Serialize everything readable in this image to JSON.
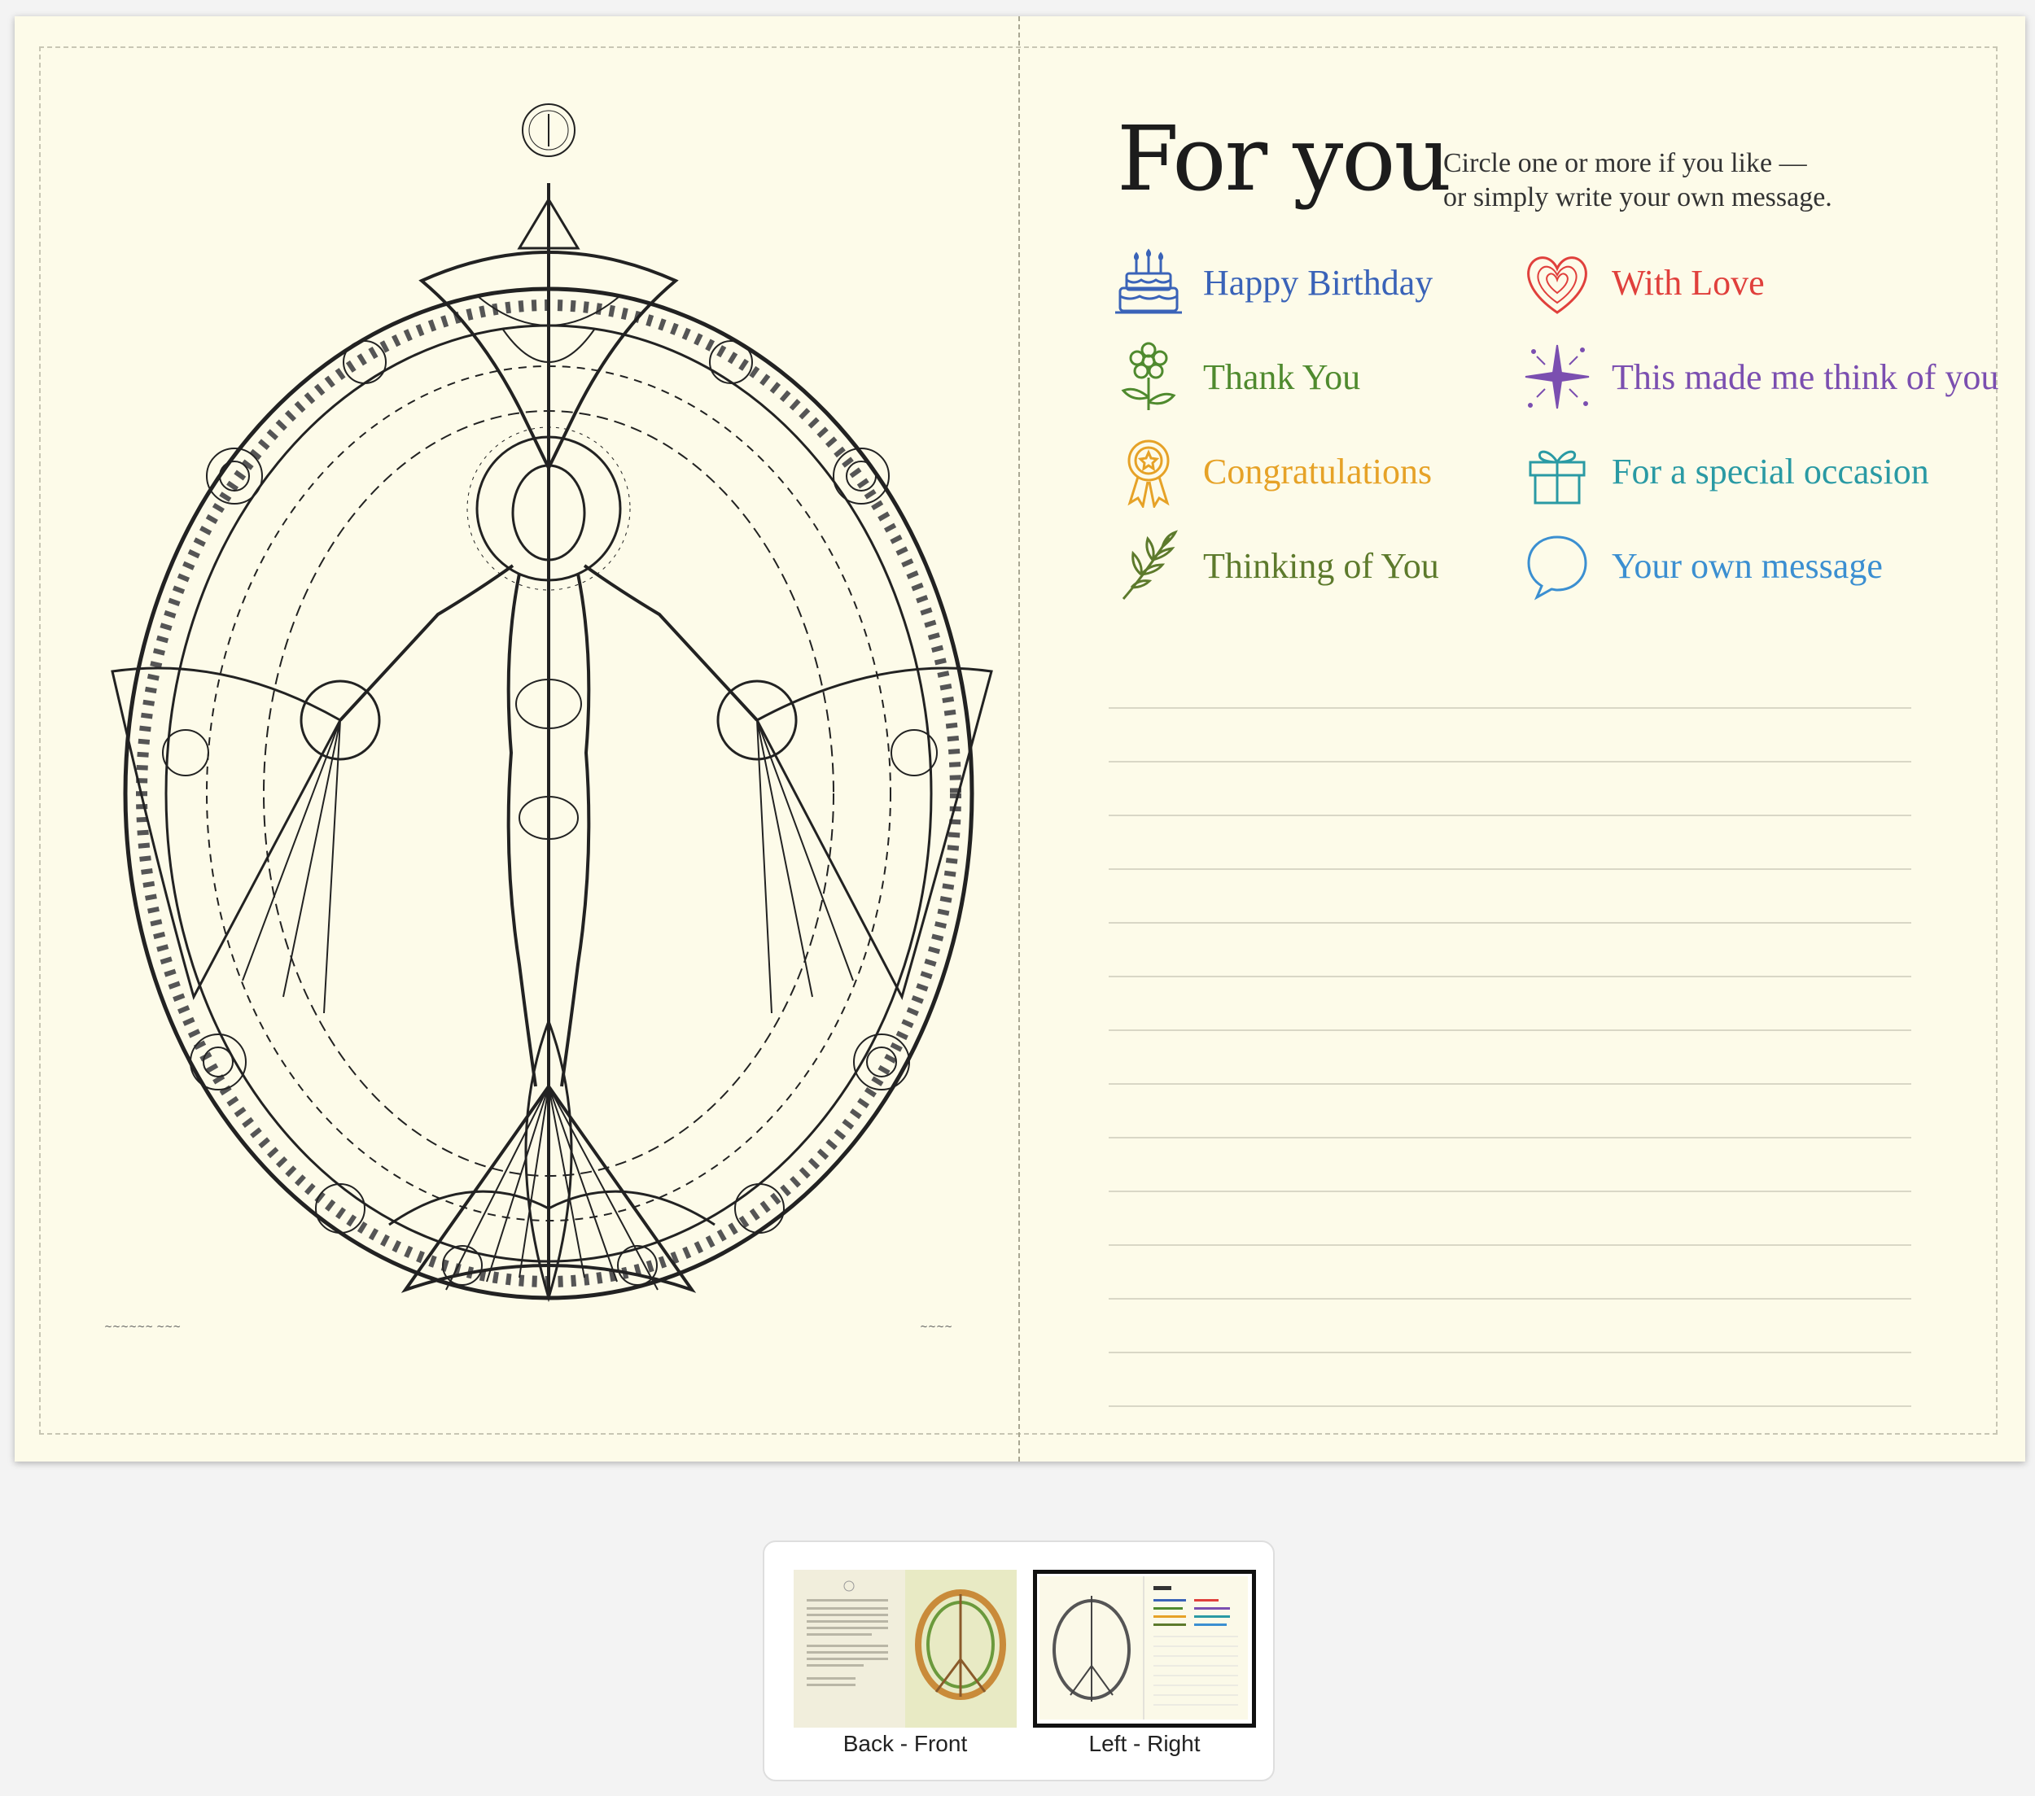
{
  "heading": "For you",
  "subheading_line1": "Circle one or more if you like —",
  "subheading_line2": "or simply write your own message.",
  "options": [
    {
      "label": "Happy Birthday",
      "icon": "birthday-cake-icon",
      "color": "#3a63b8"
    },
    {
      "label": "With Love",
      "icon": "heart-icon",
      "color": "#e0403c"
    },
    {
      "label": "Thank You",
      "icon": "flower-icon",
      "color": "#4f8a2e"
    },
    {
      "label": "This made me think of you",
      "icon": "sparkle-icon",
      "color": "#7b4fb0"
    },
    {
      "label": "Congratulations",
      "icon": "award-ribbon-icon",
      "color": "#e6a227"
    },
    {
      "label": "For a special occasion",
      "icon": "gift-icon",
      "color": "#2a9aa4"
    },
    {
      "label": "Thinking of You",
      "icon": "leafy-branch-icon",
      "color": "#5d7a2c"
    },
    {
      "label": "Your own message",
      "icon": "speech-bubble-icon",
      "color": "#3b8fd1"
    }
  ],
  "page_tabs": [
    {
      "label": "Back - Front",
      "selected": false
    },
    {
      "label": "Left - Right",
      "selected": true
    }
  ]
}
